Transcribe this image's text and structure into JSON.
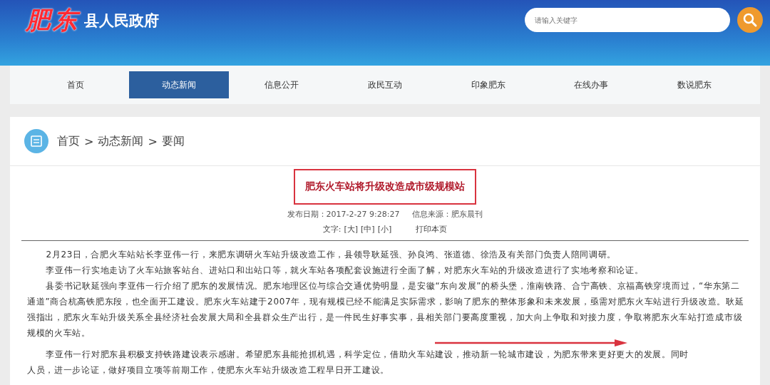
{
  "header": {
    "logo_text": "肥东",
    "site_title": "县人民政府",
    "search": {
      "placeholder": "请输入关键字"
    }
  },
  "nav": [
    {
      "label": "首页",
      "selected": false
    },
    {
      "label": "动态新闻",
      "selected": true
    },
    {
      "label": "信息公开",
      "selected": false
    },
    {
      "label": "政民互动",
      "selected": false
    },
    {
      "label": "印象肥东",
      "selected": false
    },
    {
      "label": "在线办事",
      "selected": false
    },
    {
      "label": "数说肥东",
      "selected": false
    }
  ],
  "breadcrumb": {
    "items": [
      "首页",
      "动态新闻",
      "要闻"
    ],
    "separator": ">"
  },
  "article": {
    "title": "肥东火车站将升级改造成市级规模站",
    "publish_date": "发布日期：2017-2-27  9:28:27",
    "source": "信息来源：肥东晨刊",
    "font_label": "文字:",
    "font_sizes": [
      "[大]",
      "[中]",
      "[小]"
    ],
    "print": "打印本页",
    "paragraphs": [
      {
        "text": "2月23日，合肥火车站站长李亚伟一行，来肥东调研火车站升级改造工作，县领导耿延强、孙良鸿、张道德、徐浩及有关部门负责人陪同调研。",
        "indent": true
      },
      {
        "text": "李亚伟一行实地走访了火车站旅客站台、进站口和出站口等，就火车站各项配套设施进行全面了解，对肥东火车站的升级改造进行了实地考察和论证。",
        "indent": true
      },
      {
        "text": "县委书记耿延强向李亚伟一行介绍了肥东的发展情况。肥东地理区位与综合交通优势明显，是安徽“东向发展”的桥头堡，淮南铁路、合宁高铁、京福高铁穿境而过，“华东第二通道”商合杭高铁肥东段，也全面开工建设。肥东火车站建于2007年，现有规模已经不能满足实际需求，影响了肥东的整体形象和未来发展，亟需对肥东火车站进行升级改造。耿延强指出，肥东火车站升级关系全县经济社会发展大局和全县群众生产出行，是一件民生好事实事，县相关部门要高度重视，加大向上争取和对接力度，争取将肥东火车站打造成市级规模的火车站。",
        "indent": true
      },
      {
        "text": "李亚伟一行对肥东县积极支持铁路建设表示感谢。希望肥东县能抢抓机遇，科学定位，借助火车站建设，推动新一轮城市建设，为肥东带来更好更大的发展。同时",
        "indent": true
      },
      {
        "text": "人员，进一步论证，做好项目立项等前期工作，使肥东火车站升级改造工程早日开工建设。",
        "indent": false
      }
    ]
  }
}
